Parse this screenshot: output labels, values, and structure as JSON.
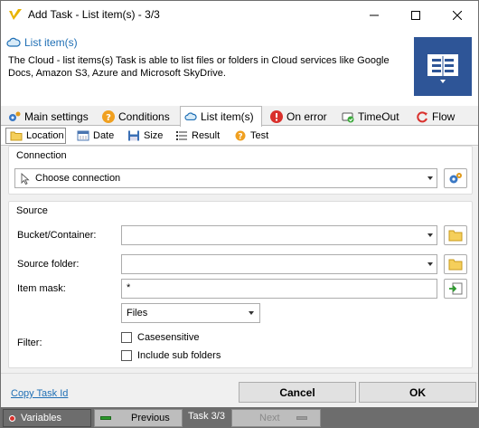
{
  "window": {
    "title": "Add Task - List item(s) - 3/3"
  },
  "header": {
    "title": "List item(s)",
    "description": "The Cloud - list items(s) Task is able to list files or folders in Cloud services like Google Docs, Amazon S3, Azure and Microsoft SkyDrive.",
    "icon": "document-list-icon",
    "icon_color": "#2e5597"
  },
  "main_tabs": [
    {
      "label": "Main settings",
      "icon": "gears-icon"
    },
    {
      "label": "Conditions",
      "icon": "help-circle-icon"
    },
    {
      "label": "List item(s)",
      "icon": "cloud-icon"
    },
    {
      "label": "On error",
      "icon": "error-icon"
    },
    {
      "label": "TimeOut",
      "icon": "timeout-icon"
    },
    {
      "label": "Flow",
      "icon": "flow-icon"
    }
  ],
  "sub_tabs": [
    {
      "label": "Location",
      "icon": "folder-icon"
    },
    {
      "label": "Date",
      "icon": "calendar-icon"
    },
    {
      "label": "Size",
      "icon": "disk-icon"
    },
    {
      "label": "Result",
      "icon": "list-icon"
    },
    {
      "label": "Test",
      "icon": "help-circle-icon"
    }
  ],
  "connection": {
    "group_title": "Connection",
    "placeholder": "Choose connection"
  },
  "source": {
    "group_title": "Source",
    "bucket_label": "Bucket/Container:",
    "bucket_value": "",
    "folder_label": "Source folder:",
    "folder_value": "",
    "mask_label": "Item mask:",
    "mask_value": "*",
    "filter_label": "Filter:",
    "filter_type": "Files",
    "case_sensitive_label": "Casesensitive",
    "case_sensitive_checked": false,
    "include_sub_label": "Include sub folders",
    "include_sub_checked": false
  },
  "footer": {
    "copy_link": "Copy Task Id",
    "cancel": "Cancel",
    "ok": "OK"
  },
  "statusbar": {
    "variables": "Variables",
    "previous": "Previous",
    "task_counter": "Task 3/3",
    "next": "Next"
  },
  "colors": {
    "accent": "#1f6fb5",
    "link": "#1f6fb5"
  }
}
